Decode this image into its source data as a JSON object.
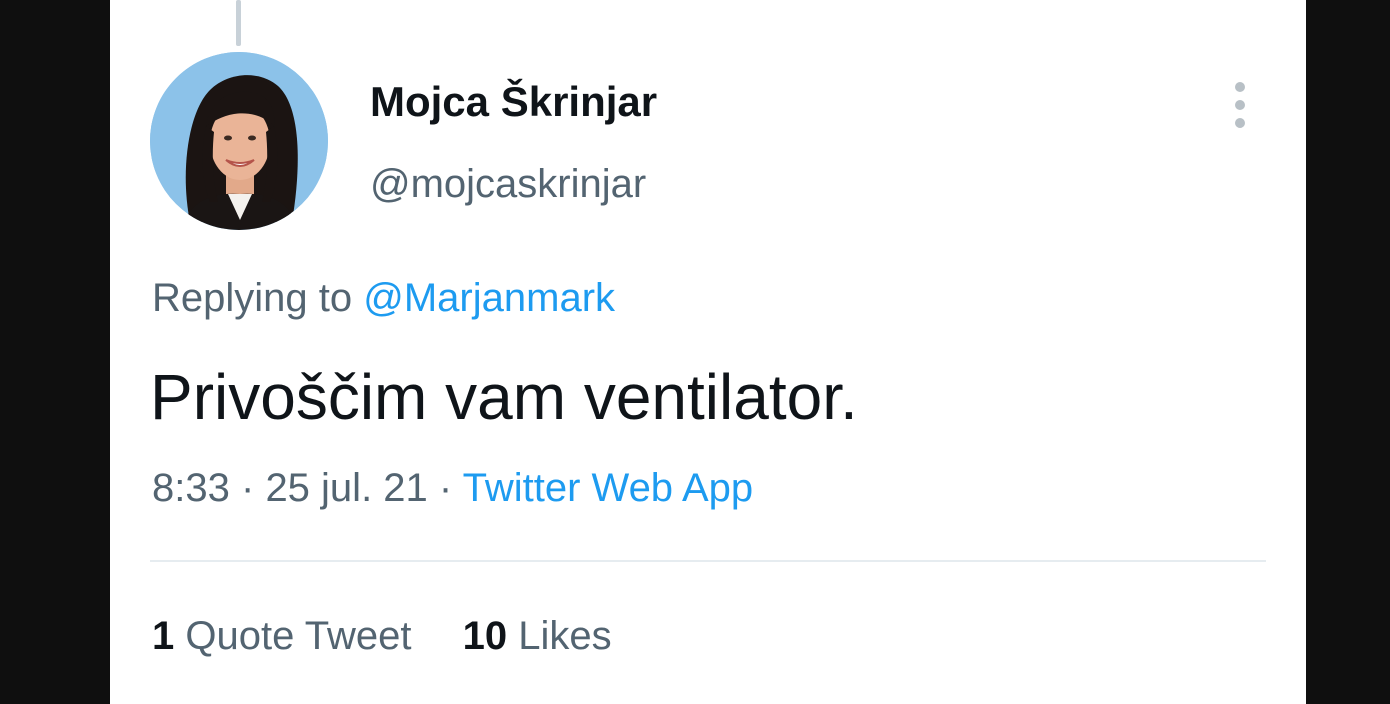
{
  "tweet": {
    "author": {
      "display_name": "Mojca Škrinjar",
      "handle": "@mojcaskrinjar"
    },
    "reply": {
      "prefix": "Replying to",
      "target": "@Marjanmark"
    },
    "text": "Privoščim vam ventilator.",
    "meta": {
      "time": "8:33",
      "separator": "·",
      "date": "25 jul. 21",
      "source": "Twitter Web App"
    },
    "stats": {
      "quote_count": "1",
      "quote_label": "Quote Tweet",
      "like_count": "10",
      "like_label": "Likes"
    }
  },
  "icons": {
    "more": "more-vertical-icon"
  },
  "colors": {
    "accent": "#1d9bf0",
    "secondary_text": "#536471",
    "primary_text": "#0f1419",
    "background": "#ffffff"
  }
}
